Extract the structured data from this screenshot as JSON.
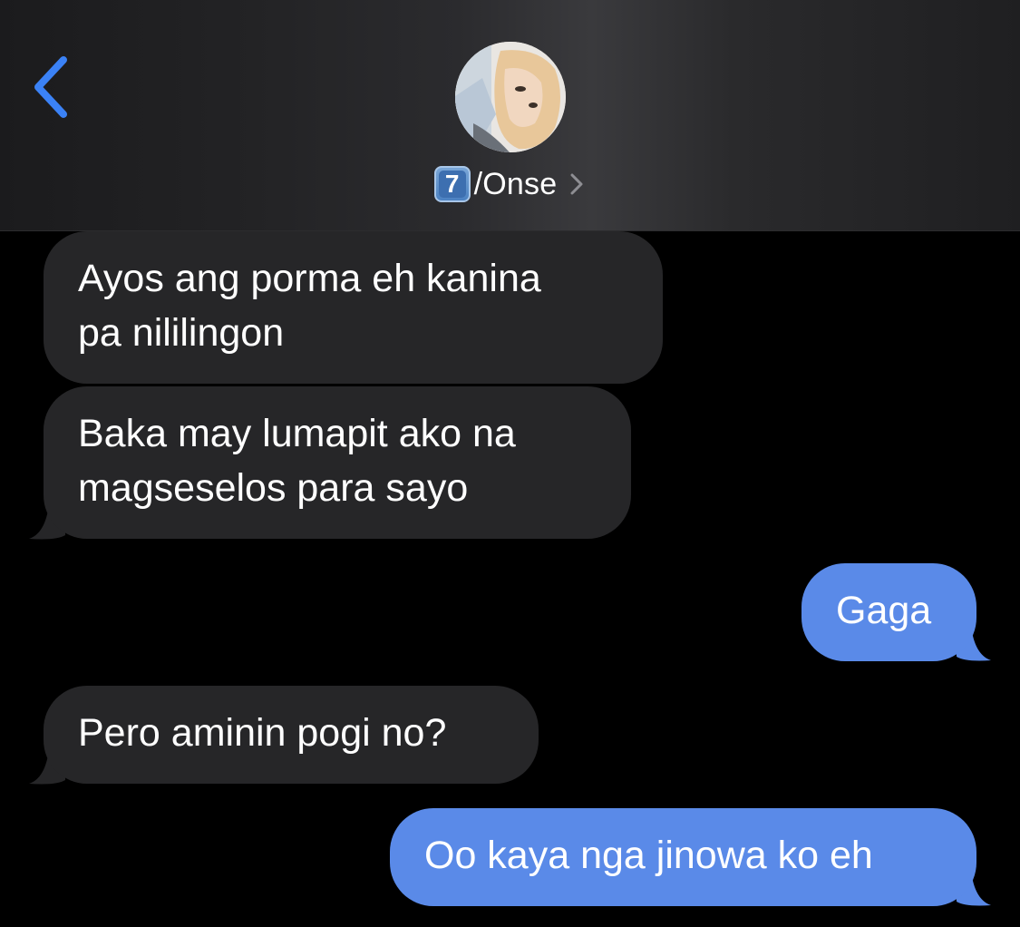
{
  "header": {
    "back_label": "",
    "contact": {
      "keycap_digit": "7",
      "name": "/Onse"
    }
  },
  "colors": {
    "incoming_bubble": "#262628",
    "outgoing_bubble": "#5a8ae8",
    "back_icon": "#3b82f6",
    "background": "#000000"
  },
  "messages": [
    {
      "direction": "incoming",
      "text": "Ayos ang porma eh kanina\npa nililingon"
    },
    {
      "direction": "incoming",
      "text": "Baka may lumapit ako na\nmagseselos para sayo"
    },
    {
      "direction": "outgoing",
      "text": "Gaga"
    },
    {
      "direction": "incoming",
      "text": "Pero aminin pogi no?"
    },
    {
      "direction": "outgoing",
      "text": "Oo kaya nga jinowa ko eh"
    }
  ]
}
